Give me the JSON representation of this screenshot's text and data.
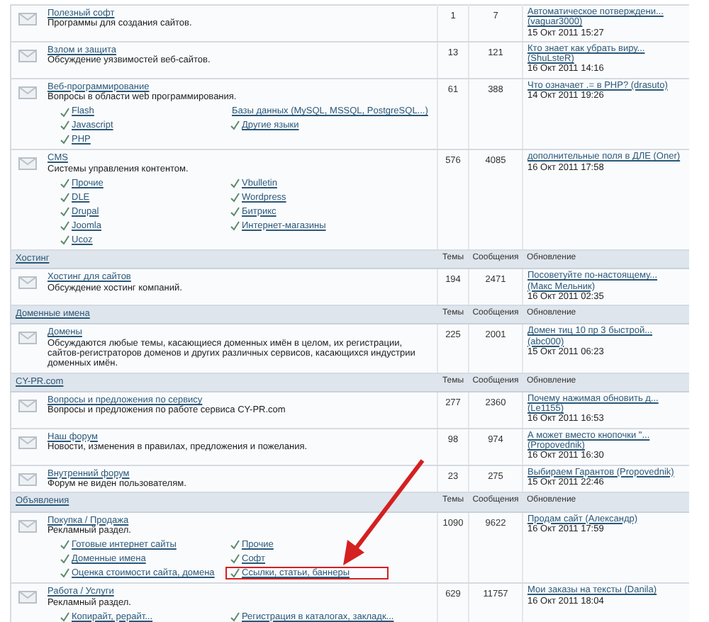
{
  "sections": [
    {
      "forums": [
        {
          "title": "Полезный софт",
          "description": "Программы для создания сайтов.",
          "topics": "1",
          "posts": "7",
          "last_post": {
            "link": "Автоматическое потверждени... (vaguar3000)",
            "date": "15 Окт 2011 15:27"
          }
        },
        {
          "title": "Взлом и защита",
          "description": "Обсуждение уязвимостей веб-сайтов.",
          "topics": "13",
          "posts": "121",
          "last_post": {
            "link": "Кто знает как убрать виру... (ShuLsteR)",
            "date": "16 Окт 2011 14:16"
          }
        },
        {
          "title": "Веб-программирование",
          "description": "Вопросы в области web программирования.",
          "subforums": [
            {
              "label": "Flash",
              "highlighted": false
            },
            {
              "label": "Javascript",
              "highlighted": false
            },
            {
              "label": "PHP",
              "highlighted": false
            },
            {
              "label": "Базы данных (MySQL, MSSQL, PostgreSQL...)",
              "highlighted": false
            },
            {
              "label": "Другие языки",
              "highlighted": false
            }
          ],
          "topics": "61",
          "posts": "388",
          "last_post": {
            "link": "Что означает .= в PHP? (drasuto)",
            "date": "14 Окт 2011 19:26"
          }
        },
        {
          "title": "CMS",
          "description": "Системы управления контентом.",
          "subforums": [
            {
              "label": "Прочие",
              "highlighted": false
            },
            {
              "label": "DLE",
              "highlighted": false
            },
            {
              "label": "Drupal",
              "highlighted": false
            },
            {
              "label": "Joomla",
              "highlighted": false
            },
            {
              "label": "Ucoz",
              "highlighted": false
            },
            {
              "label": "Vbulletin",
              "highlighted": false
            },
            {
              "label": "Wordpress",
              "highlighted": false
            },
            {
              "label": "Битрикс",
              "highlighted": false
            },
            {
              "label": "Интернет-магазины",
              "highlighted": false
            }
          ],
          "topics": "576",
          "posts": "4085",
          "last_post": {
            "link": "дополнительные поля в ДЛЕ (Oner)",
            "date": "16 Окт 2011 17:58"
          }
        }
      ]
    },
    {
      "title": "Хостинг",
      "columns": [
        "Темы",
        "Сообщения",
        "Обновление"
      ],
      "forums": [
        {
          "title": "Хостинг для сайтов",
          "description": "Обсуждение хостинг компаний.",
          "topics": "194",
          "posts": "2471",
          "last_post": {
            "link": "Посоветуйте по-настоящему... (Макс Мельник)",
            "date": "16 Окт 2011 02:35"
          }
        }
      ]
    },
    {
      "title": "Доменные имена",
      "columns": [
        "Темы",
        "Сообщения",
        "Обновление"
      ],
      "forums": [
        {
          "title": "Домены",
          "description": "Обсуждаются любые темы, касающиеся доменных имён в целом, их регистрации, сайтов-регистраторов доменов и других различных сервисов, касающихся индустрии доменных имён.",
          "topics": "225",
          "posts": "2001",
          "last_post": {
            "link": "Домен тиц 10 пр 3 быстрой... (abc000)",
            "date": "15 Окт 2011 06:23"
          }
        }
      ]
    },
    {
      "title": "CY-PR.com",
      "columns": [
        "Темы",
        "Сообщения",
        "Обновление"
      ],
      "forums": [
        {
          "title": "Вопросы и предложения по сервису",
          "description": "Вопросы и предложения по работе сервиса CY-PR.com",
          "topics": "277",
          "posts": "2360",
          "last_post": {
            "link": "Почему нажимая обновить д... (Le1155)",
            "date": "16 Окт 2011 16:53"
          }
        },
        {
          "title": "Наш форум",
          "description": "Новости, изменения в правилах, предложения и пожелания.",
          "topics": "98",
          "posts": "974",
          "last_post": {
            "link": "А может вместо кнопочки \"... (Propovednik)",
            "date": "16 Окт 2011 16:30"
          }
        },
        {
          "title": "Внутренний форум",
          "description": "Форум не виден пользователям.",
          "topics": "23",
          "posts": "275",
          "last_post": {
            "link": "Выбираем Гарантов (Propovednik)",
            "date": "15 Окт 2011 22:46"
          }
        }
      ]
    },
    {
      "title": "Объявления",
      "columns": [
        "Темы",
        "Сообщения",
        "Обновление"
      ],
      "forums": [
        {
          "title": "Покупка / Продажа",
          "description": "Рекламный раздел.",
          "subforums": [
            {
              "label": "Готовые интернет сайты",
              "highlighted": false
            },
            {
              "label": "Доменные имена",
              "highlighted": false
            },
            {
              "label": "Оценка стоимости сайта, домена",
              "highlighted": false
            },
            {
              "label": "Прочие",
              "highlighted": false
            },
            {
              "label": "Софт",
              "highlighted": false
            },
            {
              "label": "Ссылки, статьи, баннеры",
              "highlighted": true
            }
          ],
          "topics": "1090",
          "posts": "9622",
          "last_post": {
            "link": "Продам сайт (Александр)",
            "date": "16 Окт 2011 17:59"
          }
        },
        {
          "title": "Работа / Услуги",
          "description": "Рекламный раздел.",
          "subforums": [
            {
              "label": "Копирайт, рерайт...",
              "highlighted": false
            },
            {
              "label": "Регистрация в каталогах, закладк...",
              "highlighted": false
            }
          ],
          "topics": "629",
          "posts": "11757",
          "last_post": {
            "link": "Мои заказы на тексты (Danila)",
            "date": "16 Окт 2011 18:04"
          }
        }
      ]
    }
  ]
}
